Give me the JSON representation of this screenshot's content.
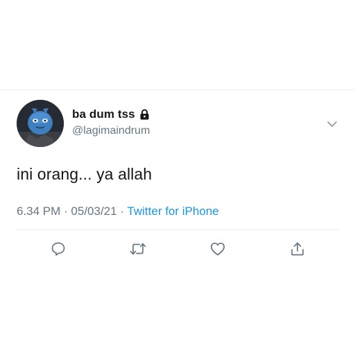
{
  "tweet": {
    "display_name": "ba dum tss",
    "handle": "@lagimaindrum",
    "text": "ini orang... ya allah",
    "time": "6.34 PM",
    "date": "05/03/21",
    "source": "Twitter for iPhone",
    "separator": " · "
  },
  "icons": {
    "lock": "lock-icon",
    "more": "chevron-down-icon",
    "reply": "reply-icon",
    "retweet": "retweet-icon",
    "like": "heart-icon",
    "share": "share-icon"
  },
  "colors": {
    "text": "#14171a",
    "secondary": "#657786",
    "link": "#1b95e0",
    "divider": "#e6ecf0"
  }
}
